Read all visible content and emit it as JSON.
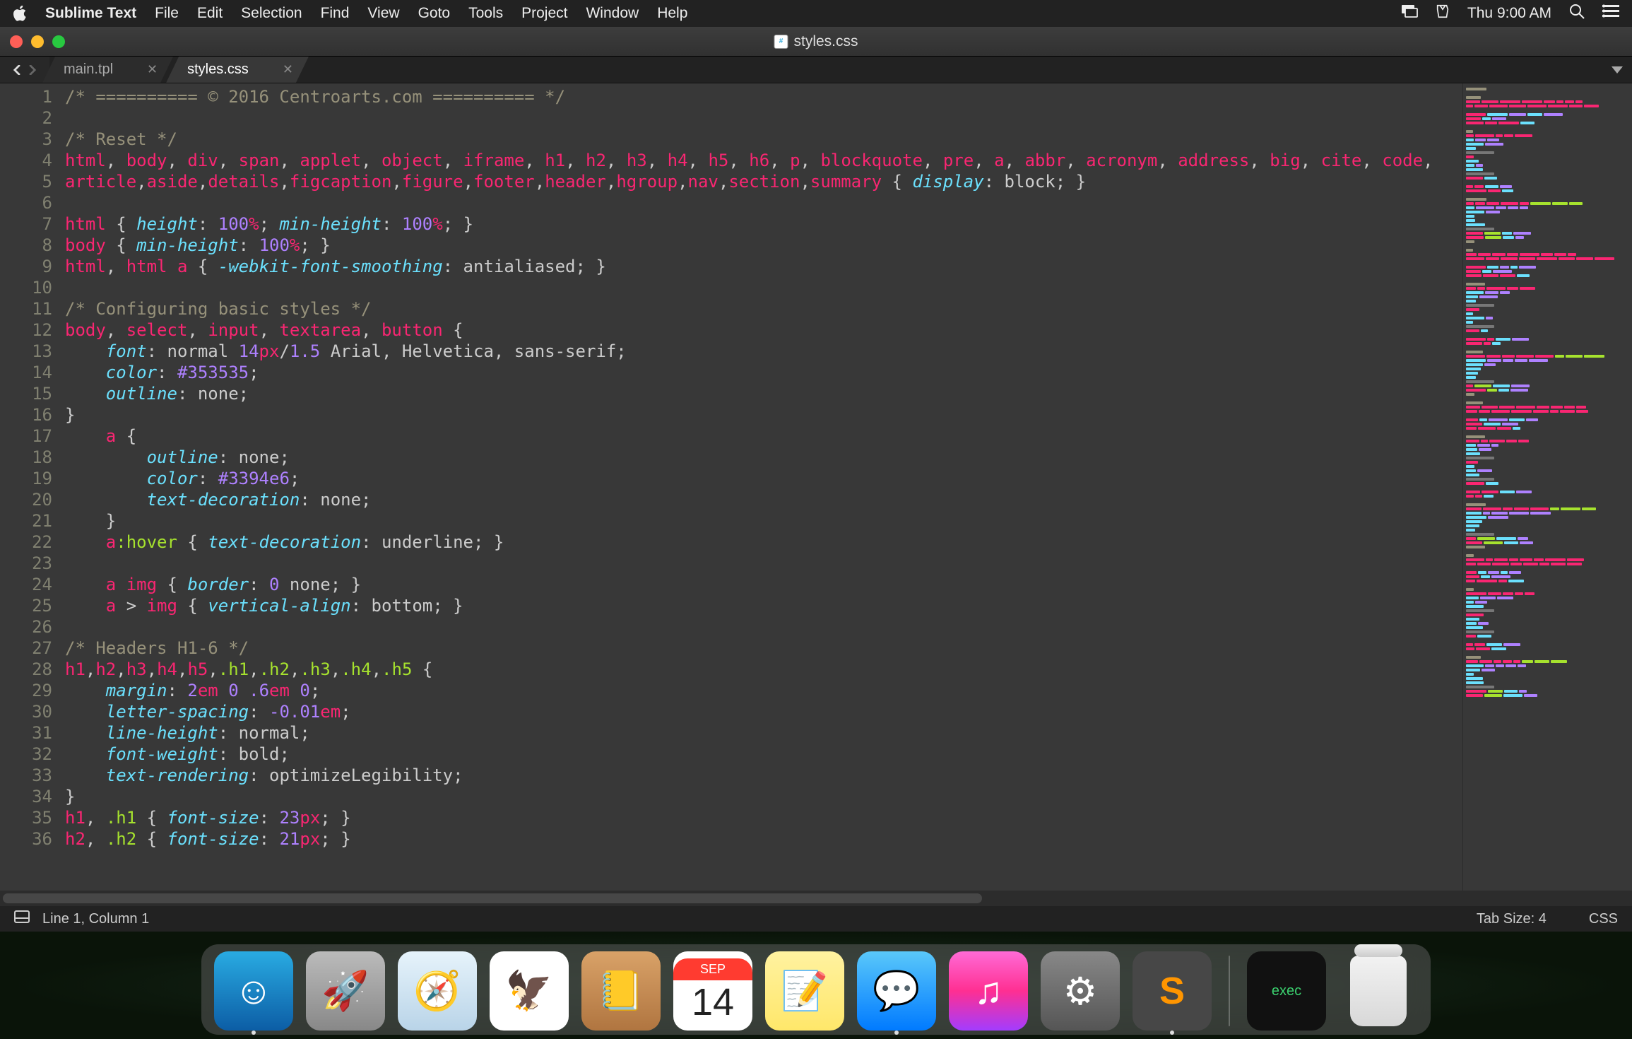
{
  "menubar": {
    "appname": "Sublime Text",
    "items": [
      "File",
      "Edit",
      "Selection",
      "Find",
      "View",
      "Goto",
      "Tools",
      "Project",
      "Window",
      "Help"
    ],
    "clock": "Thu 9:00 AM"
  },
  "window": {
    "title_file": "styles.css",
    "tabs": [
      {
        "label": "main.tpl",
        "active": false
      },
      {
        "label": "styles.css",
        "active": true
      }
    ]
  },
  "status": {
    "cursor": "Line 1, Column 1",
    "tab_size": "Tab Size: 4",
    "syntax": "CSS"
  },
  "code_lines_plain": [
    "/* ========== © 2016 Centroarts.com ========== */",
    "",
    "/* Reset */",
    "html, body, div, span, applet, object, iframe, h1, h2, h3, h4, h5, h6, p, blockquote, pre, a, abbr, acronym, address, big, cite, code,",
    "article,aside,details,figcaption,figure,footer,header,hgroup,nav,section,summary { display: block; }",
    "",
    "html { height: 100%; min-height: 100%; }",
    "body { min-height: 100%; }",
    "html, html a { -webkit-font-smoothing: antialiased; }",
    "",
    "/* Configuring basic styles */",
    "body, select, input, textarea, button {",
    "    font: normal 14px/1.5 Arial, Helvetica, sans-serif;",
    "    color: #353535;",
    "    outline: none;",
    "}",
    "    a {",
    "        outline: none;",
    "        color: #3394e6;",
    "        text-decoration: none;",
    "    }",
    "    a:hover { text-decoration: underline; }",
    "",
    "    a img { border: 0 none; }",
    "    a > img { vertical-align: bottom; }",
    "",
    "/* Headers H1-6 */",
    "h1,h2,h3,h4,h5,.h1,.h2,.h3,.h4,.h5 {",
    "    margin: 2em 0 .6em 0;",
    "    letter-spacing: -0.01em;",
    "    line-height: normal;",
    "    font-weight: bold;",
    "    text-rendering: optimizeLegibility;",
    "}",
    "h1, .h1 { font-size: 23px; }",
    "h2, .h2 { font-size: 21px; }"
  ],
  "code_lines_html": [
    "<span class=c-comment>/* ========== © 2016 Centroarts.com ========== */</span>",
    "",
    "<span class=c-comment>/* Reset */</span>",
    "<span class=c-sel>html</span>, <span class=c-sel>body</span>, <span class=c-sel>div</span>, <span class=c-sel>span</span>, <span class=c-sel>applet</span>, <span class=c-sel>object</span>, <span class=c-sel>iframe</span>, <span class=c-sel>h1</span>, <span class=c-sel>h2</span>, <span class=c-sel>h3</span>, <span class=c-sel>h4</span>, <span class=c-sel>h5</span>, <span class=c-sel>h6</span>, <span class=c-sel>p</span>, <span class=c-sel>blockquote</span>, <span class=c-sel>pre</span>, <span class=c-sel>a</span>, <span class=c-sel>abbr</span>, <span class=c-sel>acronym</span>, <span class=c-sel>address</span>, <span class=c-sel>big</span>, <span class=c-sel>cite</span>, <span class=c-sel>code</span>, ",
    "<span class=c-sel>article</span>,<span class=c-sel>aside</span>,<span class=c-sel>details</span>,<span class=c-sel>figcaption</span>,<span class=c-sel>figure</span>,<span class=c-sel>footer</span>,<span class=c-sel>header</span>,<span class=c-sel>hgroup</span>,<span class=c-sel>nav</span>,<span class=c-sel>section</span>,<span class=c-sel>summary</span> <span class=c-brace>{</span> <span class=c-prop>display</span>: block; <span class=c-brace>}</span>",
    "",
    "<span class=c-sel>html</span> <span class=c-brace>{</span> <span class=c-prop>height</span>: <span class=c-num>100</span><span class=c-unit>%</span>; <span class=c-prop>min-height</span>: <span class=c-num>100</span><span class=c-unit>%</span>; <span class=c-brace>}</span>",
    "<span class=c-sel>body</span> <span class=c-brace>{</span> <span class=c-prop>min-height</span>: <span class=c-num>100</span><span class=c-unit>%</span>; <span class=c-brace>}</span>",
    "<span class=c-sel>html</span>, <span class=c-sel>html</span> <span class=c-sel>a</span> <span class=c-brace>{</span> <span class=c-prop>-webkit-font-smoothing</span>: antialiased; <span class=c-brace>}</span>",
    "",
    "<span class=c-comment>/* Configuring basic styles */</span>",
    "<span class=c-sel>body</span>, <span class=c-sel>select</span>, <span class=c-sel>input</span>, <span class=c-sel>textarea</span>, <span class=c-sel>button</span> <span class=c-brace>{</span>",
    "    <span class=c-prop>font</span>: normal <span class=c-num>14</span><span class=c-unit>px</span>/<span class=c-num>1.5</span> Arial, Helvetica, sans-serif;",
    "    <span class=c-prop>color</span>: <span class=c-num>#353535</span>;",
    "    <span class=c-prop>outline</span>: none;",
    "<span class=c-brace>}</span>",
    "    <span class=c-sel>a</span> <span class=c-brace>{</span>",
    "        <span class=c-prop>outline</span>: none;",
    "        <span class=c-prop>color</span>: <span class=c-num>#3394e6</span>;",
    "        <span class=c-prop>text-decoration</span>: none;",
    "    <span class=c-brace>}</span>",
    "    <span class=c-sel>a</span><span class=c-pseudo>:hover</span> <span class=c-brace>{</span> <span class=c-prop>text-decoration</span>: underline; <span class=c-brace>}</span>",
    "",
    "    <span class=c-sel>a</span> <span class=c-sel>img</span> <span class=c-brace>{</span> <span class=c-prop>border</span>: <span class=c-num>0</span> none; <span class=c-brace>}</span>",
    "    <span class=c-sel>a</span> &gt; <span class=c-sel>img</span> <span class=c-brace>{</span> <span class=c-prop>vertical-align</span>: bottom; <span class=c-brace>}</span>",
    "",
    "<span class=c-comment>/* Headers H1-6 */</span>",
    "<span class=c-sel>h1</span>,<span class=c-sel>h2</span>,<span class=c-sel>h3</span>,<span class=c-sel>h4</span>,<span class=c-sel>h5</span>,<span class=c-class>.h1</span>,<span class=c-class>.h2</span>,<span class=c-class>.h3</span>,<span class=c-class>.h4</span>,<span class=c-class>.h5</span> <span class=c-brace>{</span>",
    "    <span class=c-prop>margin</span>: <span class=c-num>2</span><span class=c-unit>em</span> <span class=c-num>0</span> <span class=c-num>.6</span><span class=c-unit>em</span> <span class=c-num>0</span>;",
    "    <span class=c-prop>letter-spacing</span>: <span class=c-num>-0.01</span><span class=c-unit>em</span>;",
    "    <span class=c-prop>line-height</span>: normal;",
    "    <span class=c-prop>font-weight</span>: bold;",
    "    <span class=c-prop>text-rendering</span>: optimizeLegibility;",
    "<span class=c-brace>}</span>",
    "<span class=c-sel>h1</span>, <span class=c-class>.h1</span> <span class=c-brace>{</span> <span class=c-prop>font-size</span>: <span class=c-num>23</span><span class=c-unit>px</span>; <span class=c-brace>}</span>",
    "<span class=c-sel>h2</span>, <span class=c-class>.h2</span> <span class=c-brace>{</span> <span class=c-prop>font-size</span>: <span class=c-num>21</span><span class=c-unit>px</span>; <span class=c-brace>}</span>"
  ],
  "dock": {
    "apps": [
      {
        "name": "finder",
        "bg": "linear-gradient(#29abe2,#0c5da5)",
        "glyph": "☺",
        "running": true
      },
      {
        "name": "launchpad",
        "bg": "linear-gradient(#bbb,#888)",
        "glyph": "🚀"
      },
      {
        "name": "safari",
        "bg": "linear-gradient(#e6f3fb,#b9d4e8)",
        "glyph": "🧭"
      },
      {
        "name": "mail",
        "bg": "#fff",
        "glyph": "🦅"
      },
      {
        "name": "contacts",
        "bg": "linear-gradient(#d9a268,#b07540)",
        "glyph": "📒"
      },
      {
        "name": "calendar",
        "bg": "#fff",
        "glyph": "14",
        "text": "#222",
        "header": "SEP"
      },
      {
        "name": "notes",
        "bg": "linear-gradient(#fff2a0,#ffe76a)",
        "glyph": "📝"
      },
      {
        "name": "messages",
        "bg": "linear-gradient(#5ac8fa,#007aff)",
        "glyph": "💬",
        "running": true
      },
      {
        "name": "itunes",
        "bg": "linear-gradient(#ff6bd6,#ff2f92,#a33cff)",
        "glyph": "♫"
      },
      {
        "name": "system-preferences",
        "bg": "linear-gradient(#888,#555)",
        "glyph": "⚙"
      },
      {
        "name": "sublime-text",
        "bg": "#474747",
        "glyph": "S",
        "text": "#ff9500",
        "running": true
      }
    ],
    "right": [
      {
        "name": "terminal",
        "bg": "#111",
        "glyph": "exec",
        "text": "#3bd16f"
      }
    ]
  }
}
